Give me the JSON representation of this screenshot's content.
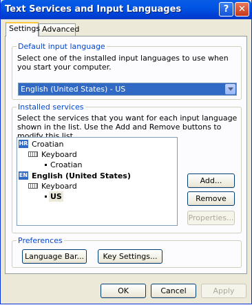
{
  "window": {
    "title": "Text Services and Input Languages",
    "help_label": "?",
    "close_label": "✕"
  },
  "tabs": [
    {
      "label": "Settings"
    },
    {
      "label": "Advanced"
    }
  ],
  "default_language": {
    "heading": "Default input language",
    "description": "Select one of the installed input languages to use when you start your computer.",
    "selected": "English (United States) - US"
  },
  "installed_services": {
    "heading": "Installed services",
    "description": "Select the services that you want for each input language shown in the list. Use the Add and Remove buttons to modify this list.",
    "tree": [
      {
        "badge": "HR",
        "label": "Croatian"
      },
      {
        "label": "Keyboard"
      },
      {
        "label": "Croatian"
      },
      {
        "badge": "EN",
        "label": "English (United States)"
      },
      {
        "label": "Keyboard"
      },
      {
        "label": "US"
      }
    ],
    "buttons": {
      "add": "Add...",
      "remove": "Remove",
      "properties": "Properties..."
    }
  },
  "preferences": {
    "heading": "Preferences",
    "language_bar": "Language Bar...",
    "key_settings": "Key Settings..."
  },
  "footer": {
    "ok": "OK",
    "cancel": "Cancel",
    "apply": "Apply"
  }
}
